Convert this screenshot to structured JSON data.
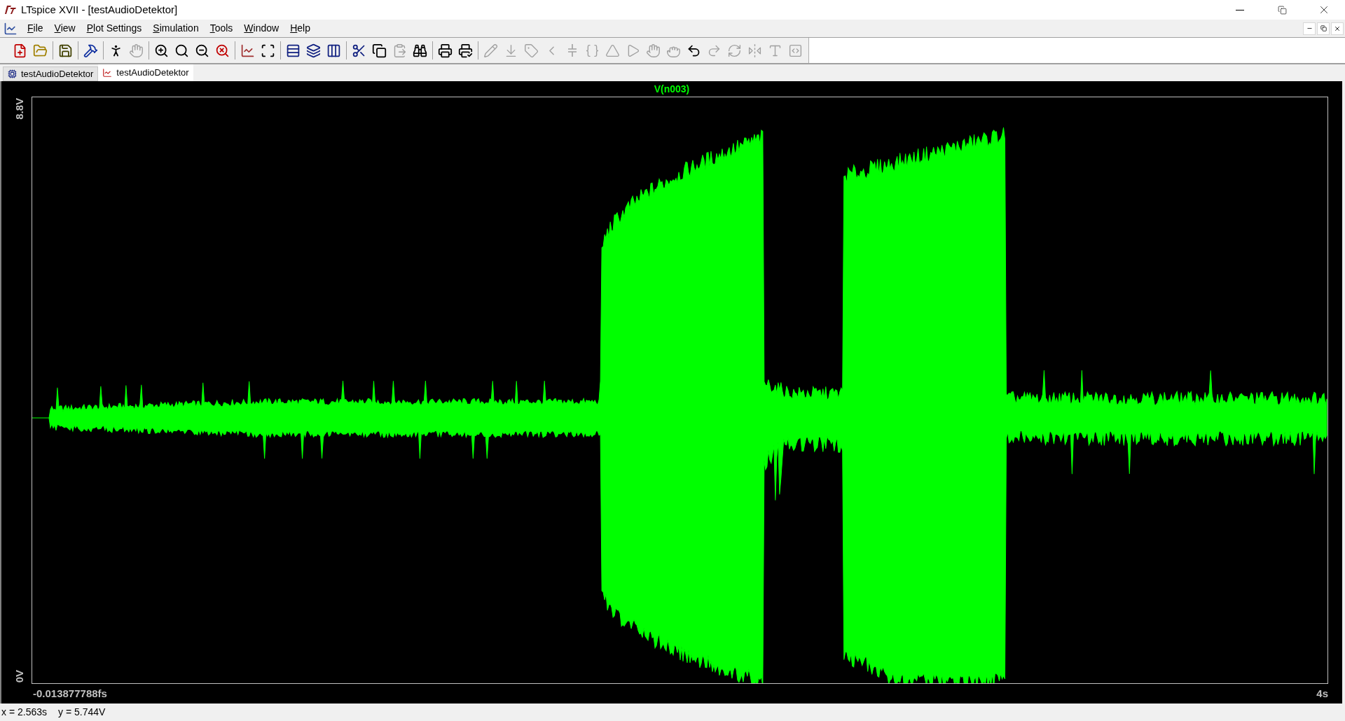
{
  "window": {
    "title": "LTspice XVII - [testAudioDetektor]"
  },
  "menu": [
    {
      "label": "File"
    },
    {
      "label": "View"
    },
    {
      "label": "Plot Settings"
    },
    {
      "label": "Simulation"
    },
    {
      "label": "Tools"
    },
    {
      "label": "Window"
    },
    {
      "label": "Help"
    }
  ],
  "toolbar": [
    {
      "disabled": false
    },
    {
      "disabled": false
    },
    {
      "disabled": false
    },
    {
      "disabled": false
    },
    {
      "disabled": false
    },
    {
      "disabled": true
    },
    {
      "disabled": false
    },
    {
      "disabled": false
    },
    {
      "disabled": false
    },
    {
      "disabled": false
    },
    {
      "disabled": false
    },
    {
      "disabled": false
    },
    {
      "disabled": false
    },
    {
      "disabled": false
    },
    {
      "disabled": false
    },
    {
      "disabled": false
    },
    {
      "disabled": false
    },
    {
      "disabled": true
    },
    {
      "disabled": false
    },
    {
      "disabled": false
    },
    {
      "disabled": false
    },
    {
      "disabled": true
    },
    {
      "disabled": true
    },
    {
      "disabled": true
    },
    {
      "disabled": true
    },
    {
      "disabled": true
    },
    {
      "disabled": true
    },
    {
      "disabled": true
    },
    {
      "disabled": true
    },
    {
      "disabled": true
    },
    {
      "disabled": true
    },
    {
      "disabled": false
    },
    {
      "disabled": true
    },
    {
      "disabled": true
    },
    {
      "disabled": true
    },
    {
      "disabled": true
    },
    {
      "disabled": true
    }
  ],
  "tabs": [
    {
      "label": "testAudioDetektor",
      "kind": "schematic",
      "selected": false
    },
    {
      "label": "testAudioDetektor",
      "kind": "waveform",
      "selected": true
    }
  ],
  "plot": {
    "trace": "V(n003)",
    "color": "#00ff00",
    "y_top": "8.8V",
    "y_bottom": "0V",
    "x_left": "-0.013877788fs",
    "x_right": "4s"
  },
  "status": [
    "x = 2.563s",
    "y = 5.744V"
  ]
}
